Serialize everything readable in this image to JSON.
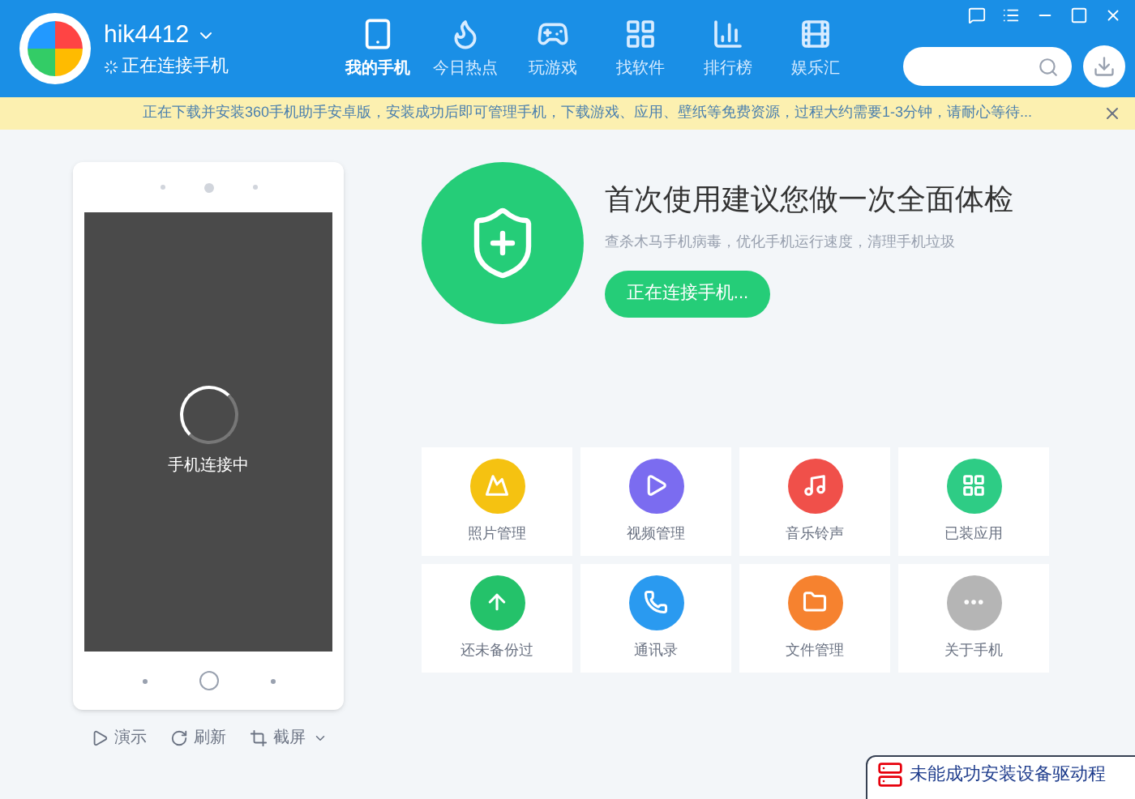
{
  "account": {
    "username": "hik4412",
    "status": "正在连接手机"
  },
  "nav": [
    {
      "kind": "phone",
      "label": "我的手机",
      "selected": true
    },
    {
      "kind": "hot",
      "label": "今日热点",
      "selected": false
    },
    {
      "kind": "game",
      "label": "玩游戏",
      "selected": false
    },
    {
      "kind": "apps",
      "label": "找软件",
      "selected": false
    },
    {
      "kind": "rank",
      "label": "排行榜",
      "selected": false
    },
    {
      "kind": "media",
      "label": "娱乐汇",
      "selected": false
    }
  ],
  "notice": "正在下载并安装360手机助手安卓版，安装成功后即可管理手机，下载游戏、应用、壁纸等免费资源，过程大约需要1-3分钟，请耐心等待...",
  "phone": {
    "status": "手机连接中",
    "actions": [
      {
        "kind": "play",
        "label": "演示"
      },
      {
        "kind": "refresh",
        "label": "刷新"
      },
      {
        "kind": "crop",
        "label": "截屏"
      }
    ]
  },
  "checkup": {
    "title": "首次使用建议您做一次全面体检",
    "subtitle": "查杀木马手机病毒，优化手机运行速度，清理手机垃圾",
    "button": "正在连接手机..."
  },
  "tools": [
    {
      "kind": "photo",
      "label": "照片管理",
      "color": "#f5c211"
    },
    {
      "kind": "video",
      "label": "视频管理",
      "color": "#7b6cf0"
    },
    {
      "kind": "music",
      "label": "音乐铃声",
      "color": "#f0504a"
    },
    {
      "kind": "apps",
      "label": "已装应用",
      "color": "#2ecc85"
    },
    {
      "kind": "backup",
      "label": "还未备份过",
      "color": "#24c26a"
    },
    {
      "kind": "contacts",
      "label": "通讯录",
      "color": "#2a9af0"
    },
    {
      "kind": "files",
      "label": "文件管理",
      "color": "#f6822f"
    },
    {
      "kind": "about",
      "label": "关于手机",
      "color": "#b5b5b5"
    }
  ],
  "toast": {
    "title": "未能成功安装设备驱动程"
  }
}
